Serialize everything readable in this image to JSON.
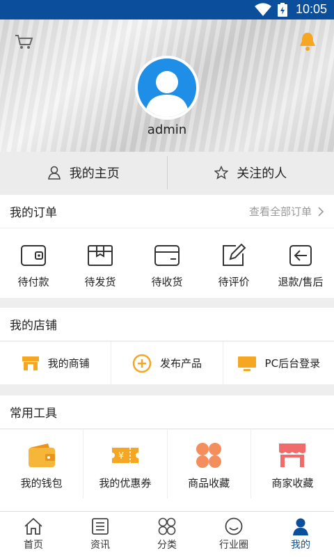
{
  "status_bar": {
    "time": "10:05",
    "icons": [
      "wifi-icon",
      "battery-icon"
    ]
  },
  "header": {
    "username": "admin",
    "icons": [
      "cart-icon",
      "bell-icon",
      "avatar-icon"
    ],
    "quick_links": [
      {
        "label": "我的主页",
        "icon": "user-icon"
      },
      {
        "label": "关注的人",
        "icon": "star-icon"
      }
    ]
  },
  "orders": {
    "title": "我的订单",
    "view_all": "查看全部订单",
    "items": [
      {
        "label": "待付款",
        "icon": "wallet-icon"
      },
      {
        "label": "待发货",
        "icon": "box-icon"
      },
      {
        "label": "待收货",
        "icon": "card-icon"
      },
      {
        "label": "待评价",
        "icon": "edit-icon"
      },
      {
        "label": "退款/售后",
        "icon": "return-icon"
      }
    ]
  },
  "shop": {
    "title": "我的店铺",
    "items": [
      {
        "label": "我的商铺",
        "icon": "store-icon"
      },
      {
        "label": "发布产品",
        "icon": "plus-circle-icon"
      },
      {
        "label": "PC后台登录",
        "icon": "monitor-icon"
      }
    ]
  },
  "tools": {
    "title": "常用工具",
    "items": [
      {
        "label": "我的钱包",
        "icon": "wallet-icon"
      },
      {
        "label": "我的优惠券",
        "icon": "coupon-icon"
      },
      {
        "label": "商品收藏",
        "icon": "clover-icon"
      },
      {
        "label": "商家收藏",
        "icon": "shop-icon"
      }
    ]
  },
  "tabbar": {
    "active": "我的",
    "items": [
      {
        "label": "首页",
        "icon": "home-icon"
      },
      {
        "label": "资讯",
        "icon": "news-icon"
      },
      {
        "label": "分类",
        "icon": "category-icon"
      },
      {
        "label": "行业圈",
        "icon": "smile-icon"
      },
      {
        "label": "我的",
        "icon": "profile-icon"
      }
    ]
  },
  "colors": {
    "status_bar": "#0b4f9c",
    "accent": "#0b4f9c",
    "orange": "#f5a623",
    "avatar": "#1e8ee6",
    "pink": "#f26b6b"
  }
}
